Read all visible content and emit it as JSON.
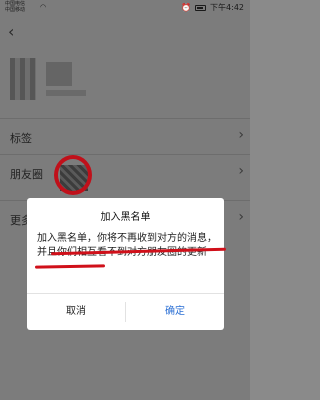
{
  "status_bar": {
    "carrier_line1": "中国电信",
    "carrier_line2": "中国移动",
    "time": "下午4:42"
  },
  "page": {
    "rows": [
      {
        "label": "标签"
      },
      {
        "label": "朋友圈"
      },
      {
        "label": "更多"
      }
    ]
  },
  "dialog": {
    "title": "加入黑名单",
    "message_part1": "加入黑名单，你将不再收到对方的消息，",
    "message_part2": "并且你们相互看不到对方朋友圈的更新",
    "cancel_label": "取消",
    "confirm_label": "确定"
  },
  "colors": {
    "confirm": "#2b6fd4",
    "annotation": "#d0101a"
  }
}
